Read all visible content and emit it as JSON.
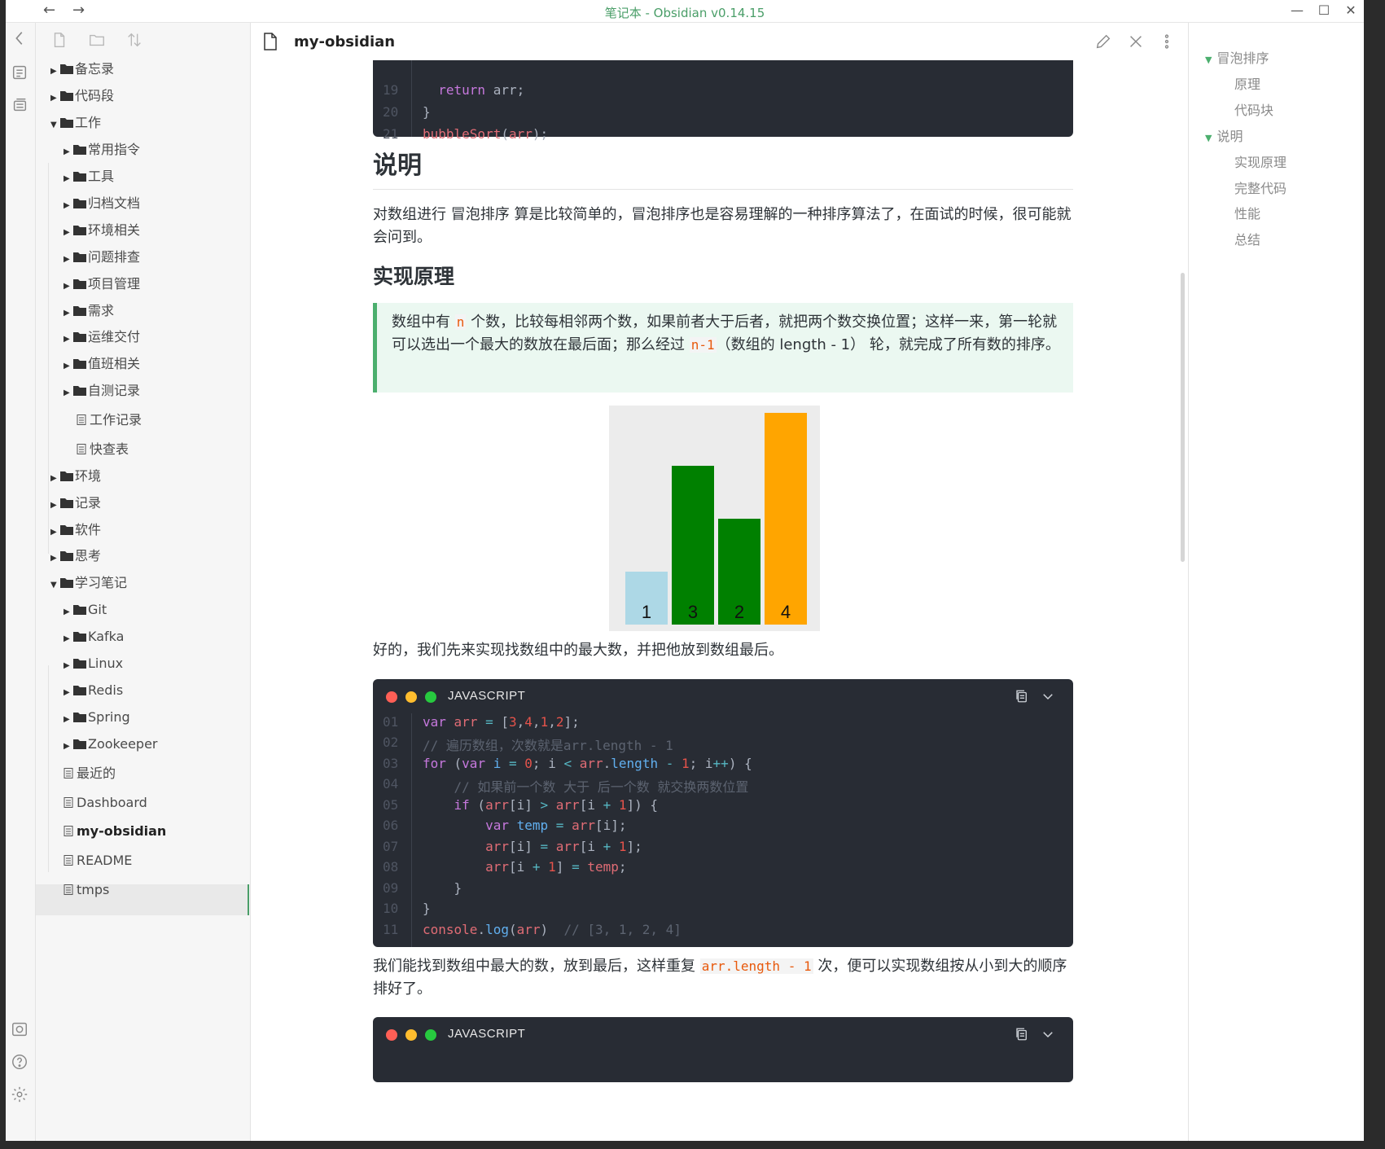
{
  "window": {
    "title": "笔记本 - Obsidian v0.14.15",
    "back_glyph": "←",
    "forward_glyph": "→",
    "minimize_glyph": "—",
    "maximize_glyph": "☐",
    "close_glyph": "✕"
  },
  "explorer": {
    "items": [
      {
        "label": "备忘录",
        "type": "folder",
        "expanded": false
      },
      {
        "label": "代码段",
        "type": "folder",
        "expanded": false
      },
      {
        "label": "工作",
        "type": "folder",
        "expanded": true
      },
      {
        "label": "常用指令",
        "type": "folder",
        "expanded": false
      },
      {
        "label": "工具",
        "type": "folder",
        "expanded": false
      },
      {
        "label": "归档文档",
        "type": "folder",
        "expanded": false
      },
      {
        "label": "环境相关",
        "type": "folder",
        "expanded": false
      },
      {
        "label": "问题排查",
        "type": "folder",
        "expanded": false
      },
      {
        "label": "项目管理",
        "type": "folder",
        "expanded": false
      },
      {
        "label": "需求",
        "type": "folder",
        "expanded": false
      },
      {
        "label": "运维交付",
        "type": "folder",
        "expanded": false
      },
      {
        "label": "值班相关",
        "type": "folder",
        "expanded": false
      },
      {
        "label": "自测记录",
        "type": "folder",
        "expanded": false
      },
      {
        "label": "工作记录",
        "type": "file"
      },
      {
        "label": "快查表",
        "type": "file"
      },
      {
        "label": "环境",
        "type": "folder",
        "expanded": false
      },
      {
        "label": "记录",
        "type": "folder",
        "expanded": false
      },
      {
        "label": "软件",
        "type": "folder",
        "expanded": false
      },
      {
        "label": "思考",
        "type": "folder",
        "expanded": false
      },
      {
        "label": "学习笔记",
        "type": "folder",
        "expanded": true
      },
      {
        "label": "Git",
        "type": "folder",
        "expanded": false
      },
      {
        "label": "Kafka",
        "type": "folder",
        "expanded": false
      },
      {
        "label": "Linux",
        "type": "folder",
        "expanded": false
      },
      {
        "label": "Redis",
        "type": "folder",
        "expanded": false
      },
      {
        "label": "Spring",
        "type": "folder",
        "expanded": false
      },
      {
        "label": "Zookeeper",
        "type": "folder",
        "expanded": false
      },
      {
        "label": "最近的",
        "type": "file"
      },
      {
        "label": "Dashboard",
        "type": "file"
      },
      {
        "label": "my-obsidian",
        "type": "file",
        "active": true
      },
      {
        "label": "README",
        "type": "file"
      },
      {
        "label": "tmps",
        "type": "file"
      }
    ]
  },
  "editor": {
    "title": "my-obsidian",
    "top_code": [
      {
        "ln": "19",
        "html_key": "return_arr"
      },
      {
        "ln": "20",
        "html_key": "close_brace"
      },
      {
        "ln": "21",
        "html_key": "call_sort"
      }
    ],
    "top_code_text": {
      "return_arr": "  return arr;",
      "close_brace": "}",
      "call_sort": "bubbleSort(arr);"
    },
    "h2": "说明",
    "intro": "对数组进行 冒泡排序 算是比较简单的，冒泡排序也是容易理解的一种排序算法了，在面试的时候，很可能就会问到。",
    "h3": "实现原理",
    "callout": {
      "part1": "数组中有 ",
      "code1": "n",
      "part2": " 个数，比较每相邻两个数，如果前者大于后者，就把两个数交换位置；这样一来，第一轮就可以选出一个最大的数放在最后面；那么经过 ",
      "code2": "n-1",
      "part3": "（数组的 length - 1） 轮，就完成了所有数的排序。"
    },
    "after_image": "好的，我们先来实现找数组中的最大数，并把他放到数组最后。",
    "code_lang": "JAVASCRIPT",
    "code_lines": [
      "01",
      "02",
      "03",
      "04",
      "05",
      "06",
      "07",
      "08",
      "09",
      "10",
      "11"
    ],
    "code_comment_1": "// 遍历数组，次数就是arr.length - 1",
    "code_comment_2": "// 如果前一个数 大于 后一个数 就交换两数位置",
    "code_comment_3": "// [3, 1, 2, 4]",
    "summary": {
      "part1": "我们能找到数组中最大的数，放到最后，这样重复 ",
      "code": "arr.length - 1",
      "part2": " 次，便可以实现数组按从小到大的顺序排好了。"
    },
    "code_lang_2": "JAVASCRIPT"
  },
  "illustration": {
    "bars": [
      {
        "label": "1",
        "value": 1,
        "color": "#add8e6"
      },
      {
        "label": "3",
        "value": 3,
        "color": "#008000"
      },
      {
        "label": "2",
        "value": 2,
        "color": "#008000"
      },
      {
        "label": "4",
        "value": 4,
        "color": "#ffa500"
      }
    ]
  },
  "outline": {
    "items": [
      {
        "label": "冒泡排序",
        "level": 1
      },
      {
        "label": "原理",
        "level": 2
      },
      {
        "label": "代码块",
        "level": 2
      },
      {
        "label": "说明",
        "level": 1
      },
      {
        "label": "实现原理",
        "level": 2
      },
      {
        "label": "完整代码",
        "level": 2
      },
      {
        "label": "性能",
        "level": 2
      },
      {
        "label": "总结",
        "level": 2
      }
    ]
  },
  "colors": {
    "accent": "#4a9e68",
    "code_bg": "#282c34",
    "callout_bg": "#ebf8f1"
  }
}
